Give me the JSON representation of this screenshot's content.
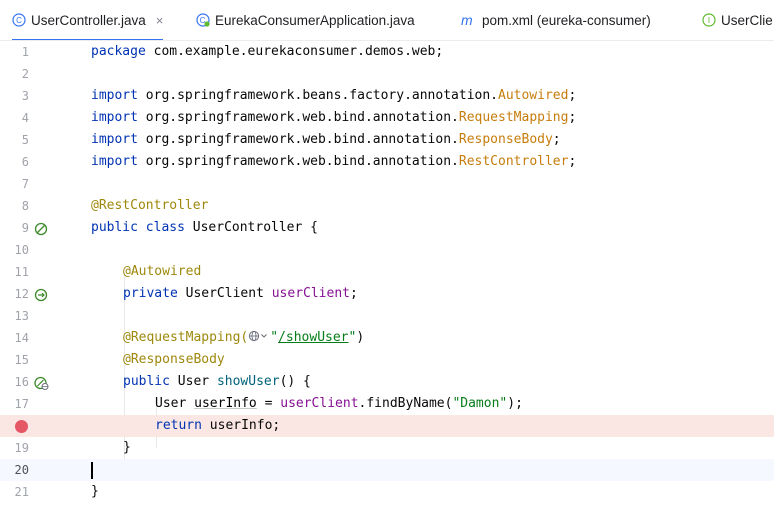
{
  "tabs": [
    {
      "label": "UserController.java",
      "icon": "class-icon",
      "active": true,
      "close": "×"
    },
    {
      "label": "EurekaConsumerApplication.java",
      "icon": "spring-class-icon",
      "active": false
    },
    {
      "label": "pom.xml (eureka-consumer)",
      "icon": "maven-icon",
      "active": false
    },
    {
      "label": "UserClie",
      "icon": "interface-icon",
      "active": false
    }
  ],
  "colors": {
    "accent": "#3574f0",
    "breakpoint": "#e55765",
    "breakpoint_line": "#fae6e3"
  },
  "lines": [
    {
      "n": "1",
      "text": "package com.example.eurekaconsumer.demos.web;"
    },
    {
      "n": "2",
      "text": ""
    },
    {
      "n": "3",
      "text": "import org.springframework.beans.factory.annotation.Autowired;"
    },
    {
      "n": "4",
      "text": "import org.springframework.web.bind.annotation.RequestMapping;"
    },
    {
      "n": "5",
      "text": "import org.springframework.web.bind.annotation.ResponseBody;"
    },
    {
      "n": "6",
      "text": "import org.springframework.web.bind.annotation.RestController;"
    },
    {
      "n": "7",
      "text": ""
    },
    {
      "n": "8",
      "text": "@RestController"
    },
    {
      "n": "9",
      "text": "public class UserController {"
    },
    {
      "n": "10",
      "text": ""
    },
    {
      "n": "11",
      "text": "    @Autowired"
    },
    {
      "n": "12",
      "text": "    private UserClient userClient;"
    },
    {
      "n": "13",
      "text": ""
    },
    {
      "n": "14",
      "text": "    @RequestMapping(\"/showUser\")"
    },
    {
      "n": "15",
      "text": "    @ResponseBody"
    },
    {
      "n": "16",
      "text": "    public User showUser() {"
    },
    {
      "n": "17",
      "text": "        User userInfo = userClient.findByName(\"Damon\");"
    },
    {
      "n": "18",
      "text": "        return userInfo;"
    },
    {
      "n": "19",
      "text": "    }"
    },
    {
      "n": "20",
      "text": ""
    },
    {
      "n": "21",
      "text": "}"
    }
  ],
  "code": {
    "l1_kw": "package",
    "l1_rest": " com.example.eurekaconsumer.demos.web;",
    "import_kw": "import",
    "l3_pkg": " org.springframework.beans.factory.annotation.",
    "l3_cls": "Autowired",
    "semi": ";",
    "l4_pkg": " org.springframework.web.bind.annotation.",
    "l4_cls": "RequestMapping",
    "l5_pkg": " org.springframework.web.bind.annotation.",
    "l5_cls": "ResponseBody",
    "l6_pkg": " org.springframework.web.bind.annotation.",
    "l6_cls": "RestController",
    "l8_ann": "@RestController",
    "l9_kw1": "public",
    "l9_kw2": "class",
    "l9_name": " UserController {",
    "l11_ann": "@Autowired",
    "l12_kw": "private",
    "l12_type": " UserClient ",
    "l12_fld": "userClient",
    "l12_end": ";",
    "l14_ann": "@RequestMapping(",
    "l14_q1": "\"",
    "l14_url": "/showUser",
    "l14_q2": "\"",
    "l14_end": ")",
    "l15_ann": "@ResponseBody",
    "l16_kw": "public",
    "l16_type": " User ",
    "l16_mth": "showUser",
    "l16_end": "() {",
    "l17_type": "User ",
    "l17_var": "userInfo",
    "l17_eq": " = ",
    "l17_fld": "userClient",
    "l17_call": ".findByName(",
    "l17_str": "\"Damon\"",
    "l17_end": ");",
    "l18_kw": "return",
    "l18_rest": " userInfo;",
    "l19": "}",
    "l21": "}"
  }
}
